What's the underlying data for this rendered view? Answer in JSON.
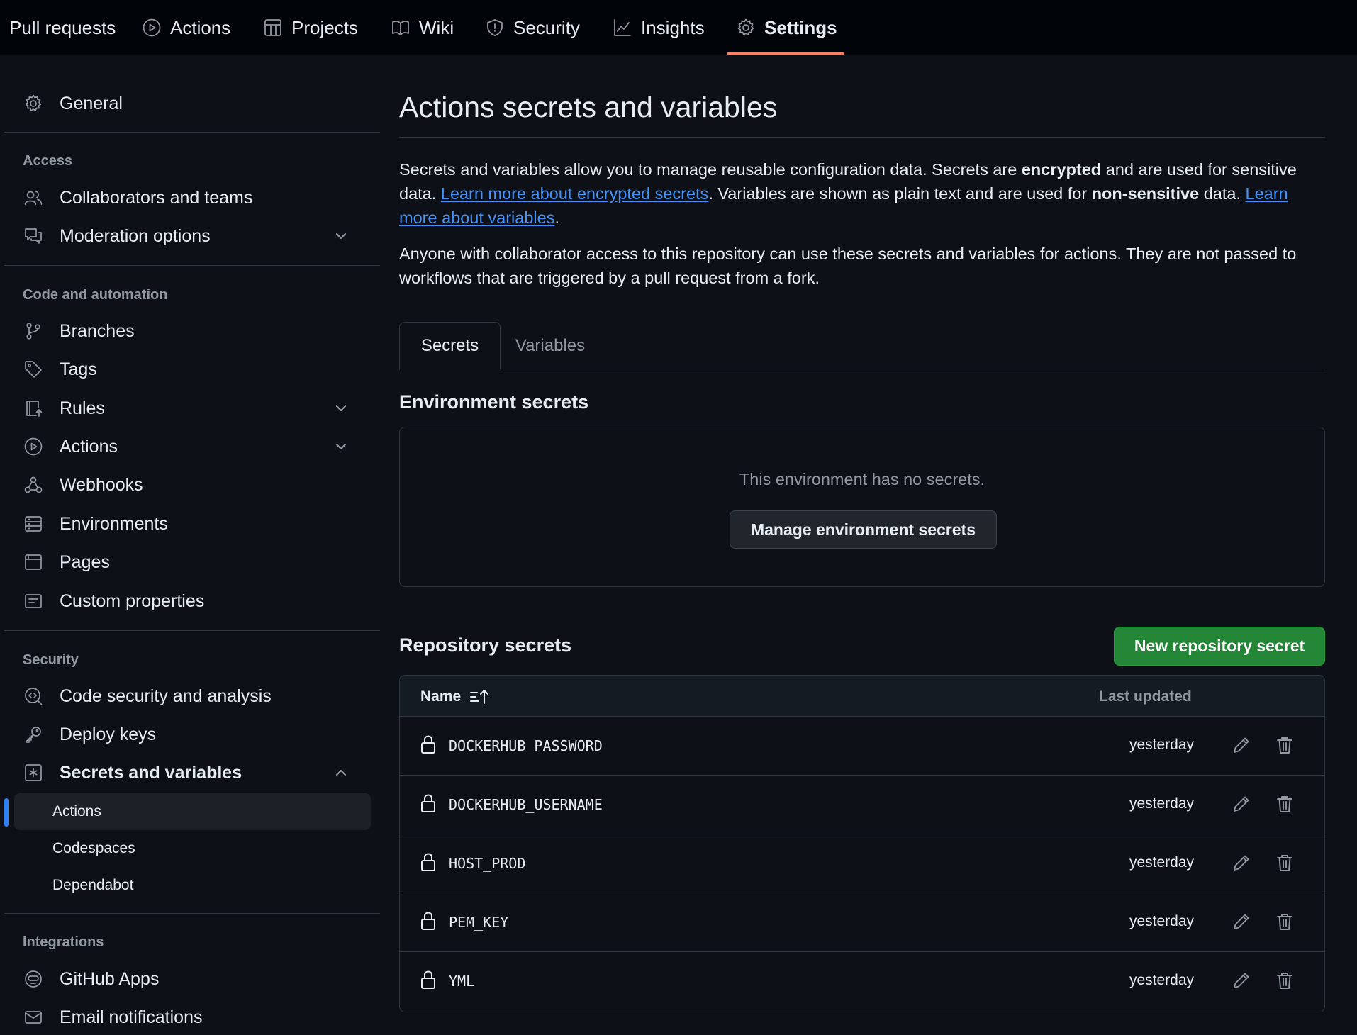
{
  "topnav": {
    "tabs": [
      {
        "label": "Pull requests",
        "icon": "pull-request-icon"
      },
      {
        "label": "Actions",
        "icon": "play-icon"
      },
      {
        "label": "Projects",
        "icon": "table-icon"
      },
      {
        "label": "Wiki",
        "icon": "book-icon"
      },
      {
        "label": "Security",
        "icon": "shield-icon"
      },
      {
        "label": "Insights",
        "icon": "graph-icon"
      },
      {
        "label": "Settings",
        "icon": "gear-icon",
        "active": true
      }
    ],
    "accent_color": "#f78166"
  },
  "sidebar": {
    "general": "General",
    "access_heading": "Access",
    "collaborators": "Collaborators and teams",
    "moderation": "Moderation options",
    "code_heading": "Code and automation",
    "branches": "Branches",
    "tags": "Tags",
    "rules": "Rules",
    "actions": "Actions",
    "webhooks": "Webhooks",
    "environments": "Environments",
    "pages": "Pages",
    "custom_properties": "Custom properties",
    "security_heading": "Security",
    "code_security": "Code security and analysis",
    "deploy_keys": "Deploy keys",
    "secrets_vars": "Secrets and variables",
    "sub_actions": "Actions",
    "sub_codespaces": "Codespaces",
    "sub_dependabot": "Dependabot",
    "integrations_heading": "Integrations",
    "github_apps": "GitHub Apps",
    "email_notifications": "Email notifications"
  },
  "main": {
    "title": "Actions secrets and variables",
    "intro": {
      "p1_a": "Secrets and variables allow you to manage reusable configuration data. Secrets are ",
      "p1_b": "encrypted",
      "p1_c": " and are used for sensitive data. ",
      "link_secrets": "Learn more about encrypted secrets",
      "p1_d": ". Variables are shown as plain text and are used for ",
      "p1_e": "non-sensitive",
      "p1_f": " data. ",
      "link_variables": "Learn more about variables",
      "p1_g": "."
    },
    "para2": "Anyone with collaborator access to this repository can use these secrets and variables for actions. They are not passed to workflows that are triggered by a pull request from a fork.",
    "tabs": {
      "secrets": "Secrets",
      "variables": "Variables"
    },
    "env_title": "Environment secrets",
    "env_empty": "This environment has no secrets.",
    "env_button": "Manage environment secrets",
    "repo_title": "Repository secrets",
    "new_button": "New repository secret",
    "table": {
      "col_name": "Name",
      "col_updated": "Last updated",
      "rows": [
        {
          "name": "DOCKERHUB_PASSWORD",
          "updated": "yesterday"
        },
        {
          "name": "DOCKERHUB_USERNAME",
          "updated": "yesterday"
        },
        {
          "name": "HOST_PROD",
          "updated": "yesterday"
        },
        {
          "name": "PEM_KEY",
          "updated": "yesterday"
        },
        {
          "name": "YML",
          "updated": "yesterday"
        }
      ]
    }
  }
}
